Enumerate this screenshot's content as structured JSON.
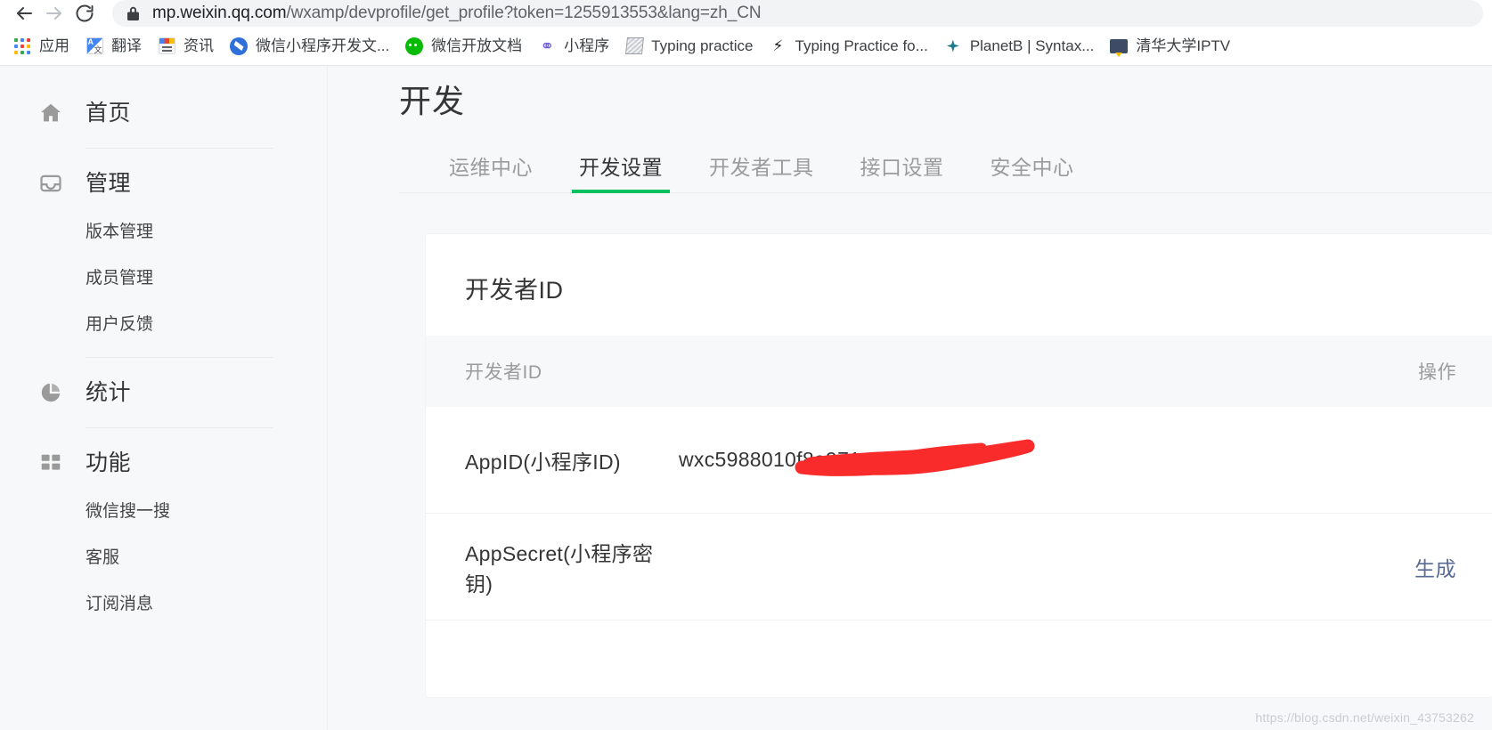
{
  "browser": {
    "nav": {
      "back_label": "Back",
      "forward_label": "Forward",
      "reload_label": "Reload"
    },
    "omnibox": {
      "lock_icon": "lock-icon",
      "url_host": "mp.weixin.qq.com",
      "url_rest": "/wxamp/devprofile/get_profile?token=1255913553&lang=zh_CN",
      "full_url": "mp.weixin.qq.com/wxamp/devprofile/get_profile?token=1255913553&lang=zh_CN"
    },
    "bookmarks": [
      {
        "label": "应用",
        "icon": "apps-grid-icon"
      },
      {
        "label": "翻译",
        "icon": "google-translate-icon"
      },
      {
        "label": "资讯",
        "icon": "google-news-icon"
      },
      {
        "label": "微信小程序开发文...",
        "icon": "wechat-doc-icon"
      },
      {
        "label": "微信开放文档",
        "icon": "wechat-icon"
      },
      {
        "label": "小程序",
        "icon": "mini-program-icon"
      },
      {
        "label": "Typing practice",
        "icon": "typing-practice-icon"
      },
      {
        "label": "Typing Practice fo...",
        "icon": "bolt-icon"
      },
      {
        "label": "PlanetB | Syntax...",
        "icon": "planetb-icon"
      },
      {
        "label": "清华大学IPTV",
        "icon": "iptv-monitor-icon"
      }
    ]
  },
  "sidebar": {
    "groups": [
      {
        "label": "首页",
        "icon": "home-icon",
        "items": [],
        "divider_after": true
      },
      {
        "label": "管理",
        "icon": "inbox-icon",
        "items": [
          "版本管理",
          "成员管理",
          "用户反馈"
        ],
        "divider_after": true
      },
      {
        "label": "统计",
        "icon": "pie-chart-icon",
        "items": [],
        "divider_after": true
      },
      {
        "label": "功能",
        "icon": "grid-icon",
        "items": [
          "微信搜一搜",
          "客服",
          "订阅消息"
        ],
        "divider_after": false
      }
    ]
  },
  "main": {
    "title": "开发",
    "tabs": [
      {
        "label": "运维中心",
        "active": false
      },
      {
        "label": "开发设置",
        "active": true
      },
      {
        "label": "开发者工具",
        "active": false
      },
      {
        "label": "接口设置",
        "active": false
      },
      {
        "label": "安全中心",
        "active": false
      }
    ],
    "active_tab_color": "#07c160",
    "card": {
      "title": "开发者ID",
      "table": {
        "columns": {
          "name": "开发者ID",
          "action": "操作"
        },
        "rows": [
          {
            "label": "AppID(小程序ID)",
            "value": "wxc5988010f8e971",
            "value_redacted": true,
            "action": ""
          },
          {
            "label": "AppSecret(小程序密钥)",
            "value": "",
            "value_redacted": false,
            "action": "生成"
          }
        ]
      }
    },
    "watermark": "https://blog.csdn.net/weixin_43753262",
    "link_color": "#576b95",
    "redaction_color": "#f92b2b"
  }
}
